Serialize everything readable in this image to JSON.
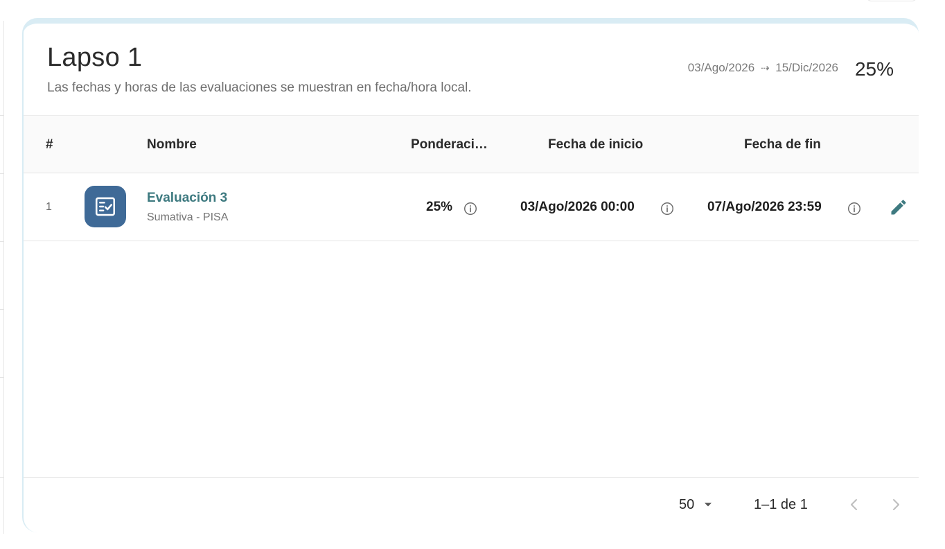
{
  "section": {
    "title": "Lapso 1",
    "subtitle": "Las fechas y horas de las evaluaciones se muestran en fecha/hora local.",
    "start_date": "03/Ago/2026",
    "end_date": "15/Dic/2026",
    "weight": "25%"
  },
  "table": {
    "columns": {
      "num": "#",
      "name": "Nombre",
      "weight": "Ponderaci…",
      "start": "Fecha de inicio",
      "end": "Fecha de fin"
    },
    "rows": [
      {
        "num": "1",
        "icon": "checklist-icon",
        "name": "Evaluación 3",
        "type": "Sumativa - PISA",
        "weight": "25%",
        "start": "03/Ago/2026 00:00",
        "end": "07/Ago/2026 23:59"
      }
    ]
  },
  "pagination": {
    "rows_per_page": "50",
    "range": "1–1 de 1"
  },
  "colors": {
    "accent_teal": "#3e7a80",
    "avatar_bg": "#3f6a97",
    "card_border": "#d9ecf4"
  }
}
